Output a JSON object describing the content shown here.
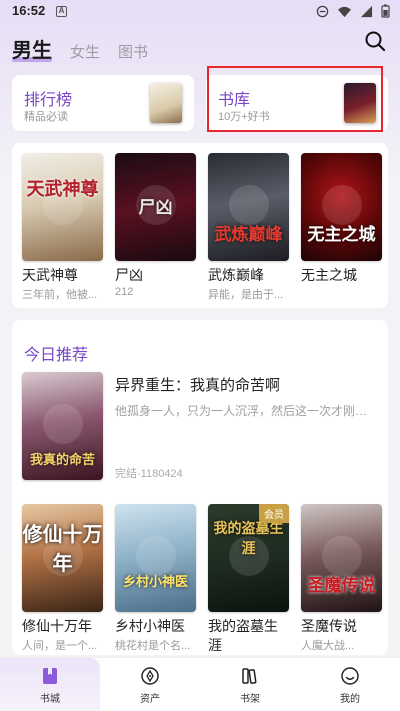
{
  "status_bar": {
    "time": "16:52",
    "notif_letter": "A"
  },
  "header": {
    "tabs": [
      {
        "label": "男生",
        "active": true
      },
      {
        "label": "女生",
        "active": false
      },
      {
        "label": "图书",
        "active": false
      }
    ],
    "search_icon": "search-icon"
  },
  "features": [
    {
      "title": "排行榜",
      "subtitle": "精品必读"
    },
    {
      "title": "书库",
      "subtitle": "10万+好书"
    }
  ],
  "top_books": [
    {
      "title": "天武神尊",
      "subtitle": "三年前，他被...",
      "cover_text": "天武神尊"
    },
    {
      "title": "尸凶",
      "subtitle": "212",
      "cover_text": "尸凶"
    },
    {
      "title": "武炼巅峰",
      "subtitle": "异能，是由于...",
      "cover_text": "武炼巅峰"
    },
    {
      "title": "无主之城",
      "subtitle": "",
      "cover_text": "无主之城"
    }
  ],
  "recommend": {
    "section_title": "今日推荐",
    "featured": {
      "title": "异界重生：我真的命苦啊",
      "description": "他孤身一人，只为一人沉浮，然后这一次才刚刚开始。",
      "meta": "完结·1180424",
      "cover_text": "我真的命苦"
    },
    "books": [
      {
        "title": "修仙十万年",
        "subtitle": "人间，是一个...",
        "cover_text": "修仙十万年",
        "vip": ""
      },
      {
        "title": "乡村小神医",
        "subtitle": "桃花村是个名...",
        "cover_text": "乡村小神医",
        "vip": ""
      },
      {
        "title": "我的盗墓生涯",
        "subtitle": "",
        "cover_text": "我的盗墓生涯",
        "vip": "会员"
      },
      {
        "title": "圣魔传说",
        "subtitle": "人魔大战...",
        "cover_text": "圣魔传说",
        "vip": ""
      }
    ]
  },
  "bottom_nav": [
    {
      "label": "书城",
      "icon": "book-icon",
      "active": true
    },
    {
      "label": "资产",
      "icon": "compass-icon",
      "active": false
    },
    {
      "label": "书架",
      "icon": "bookshelf-icon",
      "active": false
    },
    {
      "label": "我的",
      "icon": "smile-icon",
      "active": false
    }
  ]
}
